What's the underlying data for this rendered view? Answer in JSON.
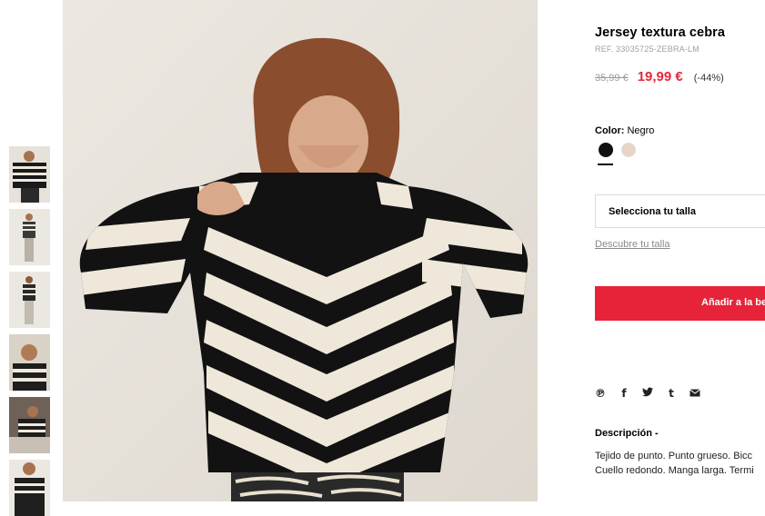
{
  "product": {
    "title": "Jersey textura cebra",
    "ref": "REF. 33035725-ZEBRA-LM",
    "price_old": "35,99 €",
    "price_new": "19,99 €",
    "discount": "(-44%)"
  },
  "color": {
    "label": "Color:",
    "value": "Negro",
    "swatches": [
      "#111111",
      "#e8d3c6"
    ]
  },
  "size": {
    "select_label": "Selecciona tu talla",
    "guide_link": "Descubre tu talla"
  },
  "cart": {
    "add_label": "Añadir a la be"
  },
  "share": {
    "icons": [
      "pinterest-icon",
      "facebook-icon",
      "twitter-icon",
      "tumblr-icon",
      "email-icon"
    ]
  },
  "description": {
    "title": "Descripción -",
    "line1": "Tejido de punto. Punto grueso. Bicc",
    "line2": "Cuello redondo. Manga larga. Termi"
  },
  "accent": "#e7233a"
}
